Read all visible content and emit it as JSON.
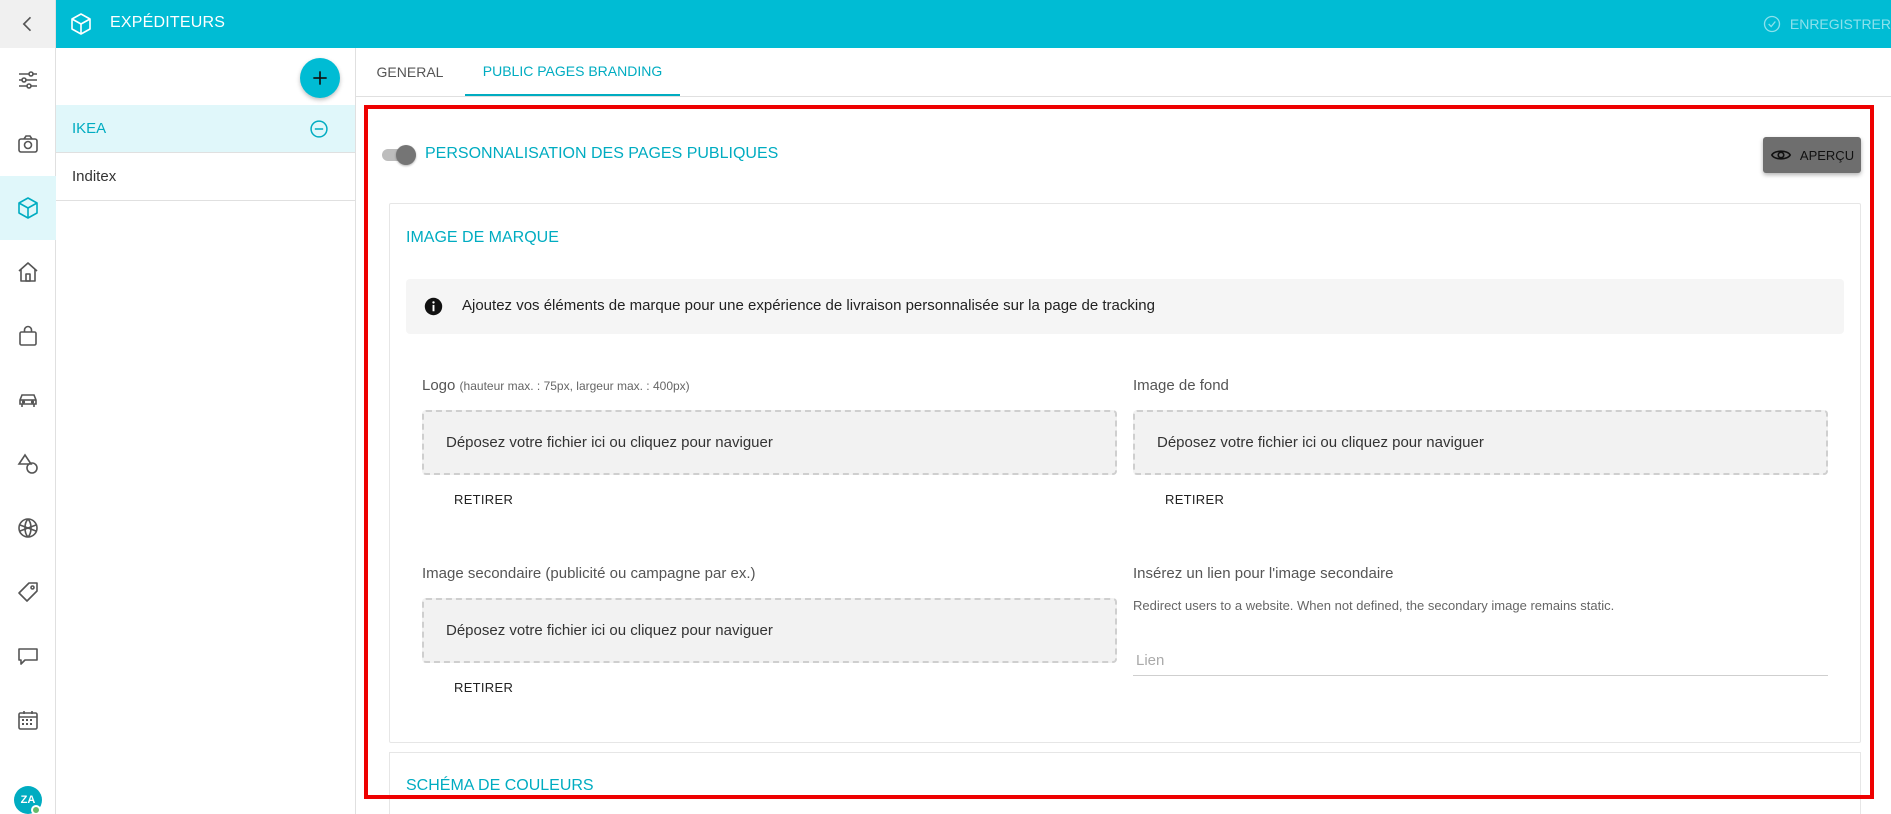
{
  "header": {
    "title": "EXPÉDITEURS",
    "save_label": "ENREGISTRER"
  },
  "rail": {
    "icons": [
      "sliders-icon",
      "camera-icon",
      "box-icon",
      "home-icon",
      "bag-icon",
      "car-icon",
      "shapes-icon",
      "globe-icon",
      "tag-icon",
      "chat-icon",
      "calendar-icon"
    ],
    "active_icon": "box-icon",
    "avatar_initials": "ZA"
  },
  "list": {
    "items": [
      {
        "label": "IKEA",
        "active": true
      },
      {
        "label": "Inditex",
        "active": false
      }
    ]
  },
  "tabs": [
    {
      "label": "GENERAL",
      "active": false
    },
    {
      "label": "PUBLIC PAGES BRANDING",
      "active": true
    }
  ],
  "branding": {
    "toggle_label": "PERSONNALISATION DES PAGES PUBLIQUES",
    "toggle_on": false,
    "preview_label": "APERÇU",
    "section_title": "IMAGE DE MARQUE",
    "info_text": "Ajoutez vos éléments de marque pour une expérience de livraison personnalisée sur la page de tracking",
    "logo_label": "Logo",
    "logo_hint": "(hauteur max. : 75px, largeur max. : 400px)",
    "background_label": "Image de fond",
    "secondary_label": "Image secondaire (publicité ou campagne par ex.)",
    "link_label": "Insérez un lien pour l'image secondaire",
    "link_help": "Redirect users to a website. When not defined, the secondary image remains static.",
    "link_placeholder": "Lien",
    "link_value": "",
    "dropzone_text": "Déposez votre fichier ici ou cliquez pour naviguer",
    "remove_label": "RETIRER",
    "color_section_title": "SCHÉMA DE COULEURS"
  },
  "colors": {
    "accent": "#00bcd4",
    "highlight_frame": "#ee0000"
  }
}
